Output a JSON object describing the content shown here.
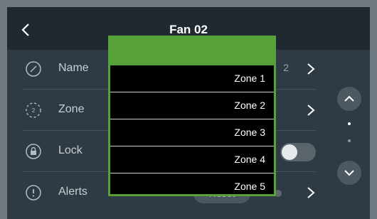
{
  "header": {
    "title": "Fan 02",
    "back_icon": "chevron-left-icon"
  },
  "settings": {
    "rows": [
      {
        "label": "Name",
        "icon": "edit-circle-icon",
        "value": "2"
      },
      {
        "label": "Zone",
        "icon": "zone-icon"
      },
      {
        "label": "Lock",
        "icon": "lock-icon",
        "toggle_on": false
      },
      {
        "label": "Alerts",
        "icon": "alert-icon",
        "reset_label": "Reset"
      }
    ]
  },
  "dropdown": {
    "options": [
      "Zone 1",
      "Zone 2",
      "Zone 3",
      "Zone 4",
      "Zone 5"
    ]
  },
  "scroll": {
    "up_icon": "chevron-up-icon",
    "down_icon": "chevron-down-icon"
  },
  "colors": {
    "accent": "#56a238",
    "background": "#2e3b44",
    "header": "#20292f"
  }
}
